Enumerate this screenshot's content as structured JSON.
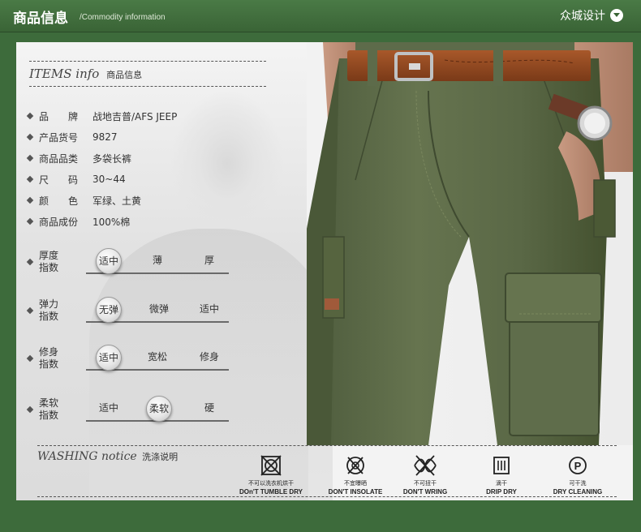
{
  "header": {
    "title_cn": "商品信息",
    "title_en": "/Commodity information",
    "brand": "众城设计",
    "brand_icon": "chevron-down-circle-icon"
  },
  "items": {
    "title_en": "ITEMS info",
    "title_cn": "商品信息"
  },
  "specs": [
    {
      "label": "品　　牌",
      "value": "战地吉普/AFS JEEP"
    },
    {
      "label": "产品货号",
      "value": "9827"
    },
    {
      "label": "商品品类",
      "value": "多袋长裤"
    },
    {
      "label": "尺　　码",
      "value": "30~44"
    },
    {
      "label": "颜　　色",
      "value": "军绿、土黄"
    },
    {
      "label": "商品成份",
      "value": "100%棉"
    }
  ],
  "indices": [
    {
      "label": "厚度指数",
      "options": [
        "适中",
        "薄",
        "厚"
      ],
      "selected": 0
    },
    {
      "label": "弹力指数",
      "options": [
        "无弹",
        "微弹",
        "适中"
      ],
      "selected": 0
    },
    {
      "label": "修身指数",
      "options": [
        "适中",
        "宽松",
        "修身"
      ],
      "selected": 0
    },
    {
      "label": "柔软指数",
      "options": [
        "适中",
        "柔软",
        "硬"
      ],
      "selected": 1
    }
  ],
  "washing": {
    "title_en": "WASHING notice",
    "title_cn": "洗涤说明",
    "items": [
      {
        "icon": "no-tumble-dry-icon",
        "cn": "不可以洗衣机烘干",
        "en": "DOn'T TUMBLE DRY"
      },
      {
        "icon": "no-sun-dry-icon",
        "cn": "不宜曝晒",
        "en": "DON'T INSOLATE"
      },
      {
        "icon": "no-wring-icon",
        "cn": "不可扭干",
        "en": "DON'T WRING"
      },
      {
        "icon": "drip-dry-icon",
        "cn": "滴干",
        "en": "DRIP DRY"
      },
      {
        "icon": "dry-clean-icon",
        "cn": "可干洗",
        "en": "DRY CLEANING"
      }
    ]
  },
  "colors": {
    "frame_green": "#3d6b3b",
    "pants_green": "#5d6b4a",
    "belt_brown": "#8e4a22"
  }
}
